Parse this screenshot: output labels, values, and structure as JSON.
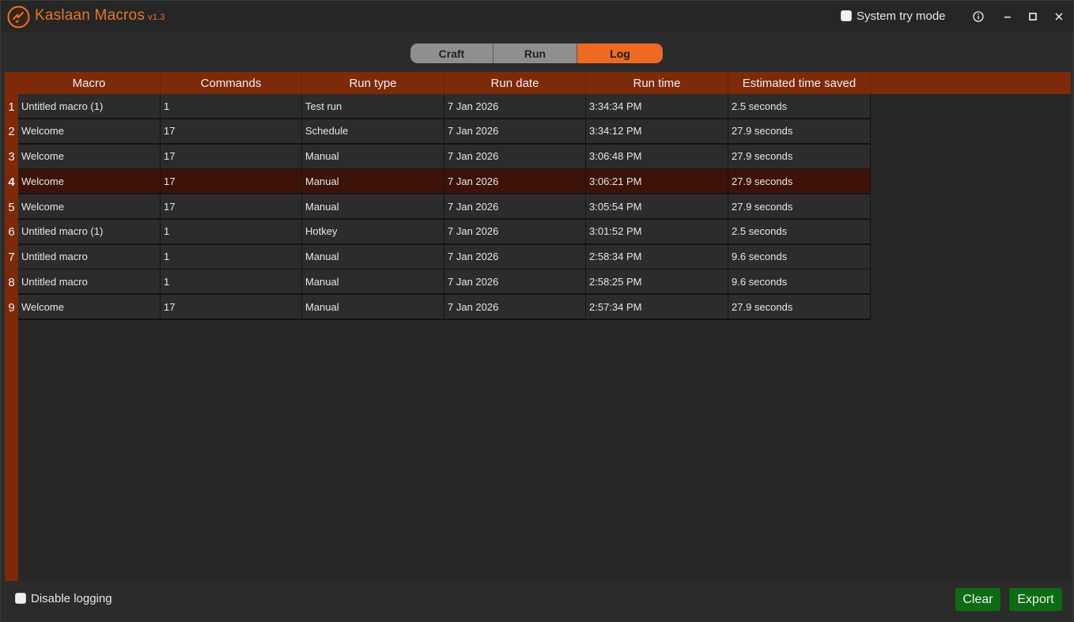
{
  "app": {
    "name": "Kaslaan Macros",
    "version": "v1.3",
    "accent_color": "#ee6a23"
  },
  "titlebar": {
    "tray_mode_label": "System try mode",
    "tray_mode_checked": false,
    "icons": [
      "info-icon",
      "minimize-icon",
      "maximize-icon",
      "close-icon"
    ]
  },
  "tabs": [
    {
      "label": "Craft",
      "active": false
    },
    {
      "label": "Run",
      "active": false
    },
    {
      "label": "Log",
      "active": true
    }
  ],
  "table": {
    "columns": [
      "Macro",
      "Commands",
      "Run type",
      "Run date",
      "Run time",
      "Estimated time saved"
    ],
    "selected_row": 4,
    "rows": [
      {
        "num": "1",
        "macro": "Untitled macro (1)",
        "commands": "1",
        "run_type": "Test run",
        "run_date": "7 Jan 2026",
        "run_time": "3:34:34 PM",
        "saved": "2.5 seconds"
      },
      {
        "num": "2",
        "macro": "Welcome",
        "commands": "17",
        "run_type": "Schedule",
        "run_date": "7 Jan 2026",
        "run_time": "3:34:12 PM",
        "saved": "27.9 seconds"
      },
      {
        "num": "3",
        "macro": "Welcome",
        "commands": "17",
        "run_type": "Manual",
        "run_date": "7 Jan 2026",
        "run_time": "3:06:48 PM",
        "saved": "27.9 seconds"
      },
      {
        "num": "4",
        "macro": "Welcome",
        "commands": "17",
        "run_type": "Manual",
        "run_date": "7 Jan 2026",
        "run_time": "3:06:21 PM",
        "saved": "27.9 seconds"
      },
      {
        "num": "5",
        "macro": "Welcome",
        "commands": "17",
        "run_type": "Manual",
        "run_date": "7 Jan 2026",
        "run_time": "3:05:54 PM",
        "saved": "27.9 seconds"
      },
      {
        "num": "6",
        "macro": "Untitled macro (1)",
        "commands": "1",
        "run_type": "Hotkey",
        "run_date": "7 Jan 2026",
        "run_time": "3:01:52 PM",
        "saved": "2.5 seconds"
      },
      {
        "num": "7",
        "macro": "Untitled macro",
        "commands": "1",
        "run_type": "Manual",
        "run_date": "7 Jan 2026",
        "run_time": "2:58:34 PM",
        "saved": "9.6 seconds"
      },
      {
        "num": "8",
        "macro": "Untitled macro",
        "commands": "1",
        "run_type": "Manual",
        "run_date": "7 Jan 2026",
        "run_time": "2:58:25 PM",
        "saved": "9.6 seconds"
      },
      {
        "num": "9",
        "macro": "Welcome",
        "commands": "17",
        "run_type": "Manual",
        "run_date": "7 Jan 2026",
        "run_time": "2:57:34 PM",
        "saved": "27.9 seconds"
      }
    ]
  },
  "footer": {
    "disable_logging_label": "Disable logging",
    "disable_logging_checked": false,
    "clear_label": "Clear",
    "export_label": "Export",
    "button_color": "#0d6b14"
  }
}
